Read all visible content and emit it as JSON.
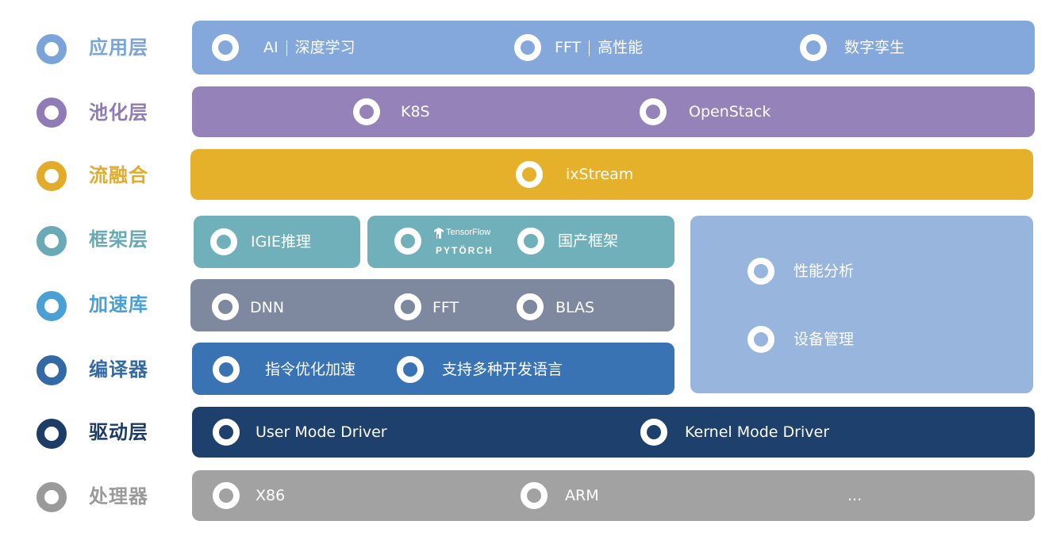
{
  "layers": [
    {
      "label": "应用层",
      "color": "#7aa3d9"
    },
    {
      "label": "池化层",
      "color": "#8f7bb5"
    },
    {
      "label": "流融合",
      "color": "#e2ab2a"
    },
    {
      "label": "框架层",
      "color": "#6aaab6"
    },
    {
      "label": "加速库",
      "color": "#4a9fd4"
    },
    {
      "label": "编译器",
      "color": "#336aa6"
    },
    {
      "label": "驱动层",
      "color": "#1d3c66"
    },
    {
      "label": "处理器",
      "color": "#9a9a9a"
    }
  ],
  "app": {
    "ai": "AI",
    "ai_sub": "深度学习",
    "fft": "FFT",
    "fft_sub": "高性能",
    "twin": "数字孪生"
  },
  "pool": {
    "k8s": "K8S",
    "openstack": "OpenStack"
  },
  "stream": {
    "ixstream": "ixStream"
  },
  "framework": {
    "igie": "IGIE推理",
    "tensorflow": "TensorFlow",
    "pytorch": "PYTÖRCH",
    "domestic": "国产框架"
  },
  "tools": {
    "perf": "性能分析",
    "device": "设备管理"
  },
  "accel": {
    "dnn": "DNN",
    "fft": "FFT",
    "blas": "BLAS"
  },
  "compiler": {
    "instr": "指令优化加速",
    "multi": "支持多种开发语言"
  },
  "driver": {
    "user": "User Mode Driver",
    "kernel": "Kernel Mode Driver"
  },
  "processor": {
    "x86": "X86",
    "arm": "ARM",
    "more": "..."
  },
  "colors": {
    "app_bar": "#84a8dc",
    "pool_bar": "#9582b8",
    "stream_bar": "#e5b12b",
    "framework_bar": "#70b0bb",
    "tools_panel": "#98b5dd",
    "accel_bar": "#7e89a0",
    "compiler_bar": "#3a73b4",
    "driver_bar": "#1e406c",
    "processor_bar": "#a2a2a2"
  }
}
